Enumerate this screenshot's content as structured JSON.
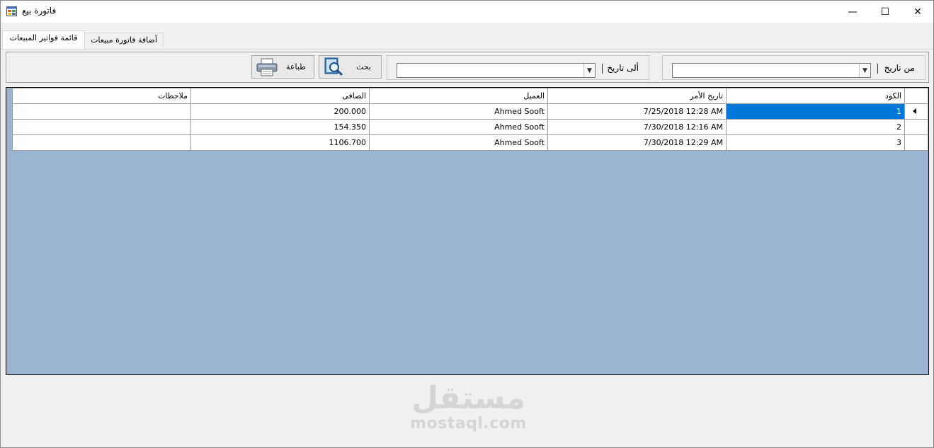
{
  "window": {
    "title": "فاتورة بيع",
    "controls": {
      "minimize": "—",
      "maximize": "☐",
      "close": "✕"
    }
  },
  "tabs": [
    {
      "label": "قائمة فواتير المبيعات",
      "active": true
    },
    {
      "label": "أضافة فاتورة مبيعات",
      "active": false
    }
  ],
  "filters": {
    "from_label": "من تاريخ",
    "from_value": "",
    "to_label": "ألى تاريخ",
    "to_value": "",
    "search_label": "بحث",
    "print_label": "طباعة"
  },
  "grid": {
    "columns": [
      "الكود",
      "تاريخ الأمر",
      "العميل",
      "الصافى",
      "ملاحظات"
    ],
    "rows": [
      {
        "code": "1",
        "date": "7/25/2018 12:28 AM",
        "customer": "Ahmed Sooft",
        "net": "200.000",
        "notes": ""
      },
      {
        "code": "2",
        "date": "7/30/2018 12:16 AM",
        "customer": "Ahmed Sooft",
        "net": "154.350",
        "notes": ""
      },
      {
        "code": "3",
        "date": "7/30/2018 12:29 AM",
        "customer": "Ahmed Sooft",
        "net": "1106.700",
        "notes": ""
      }
    ],
    "selected_row": 0
  },
  "watermark": {
    "arabic": "مستقل",
    "latin": "mostaql.com"
  },
  "colors": {
    "selection": "#0078d7",
    "grid_background": "#9ab3d1",
    "window": "#f0f0f0"
  }
}
